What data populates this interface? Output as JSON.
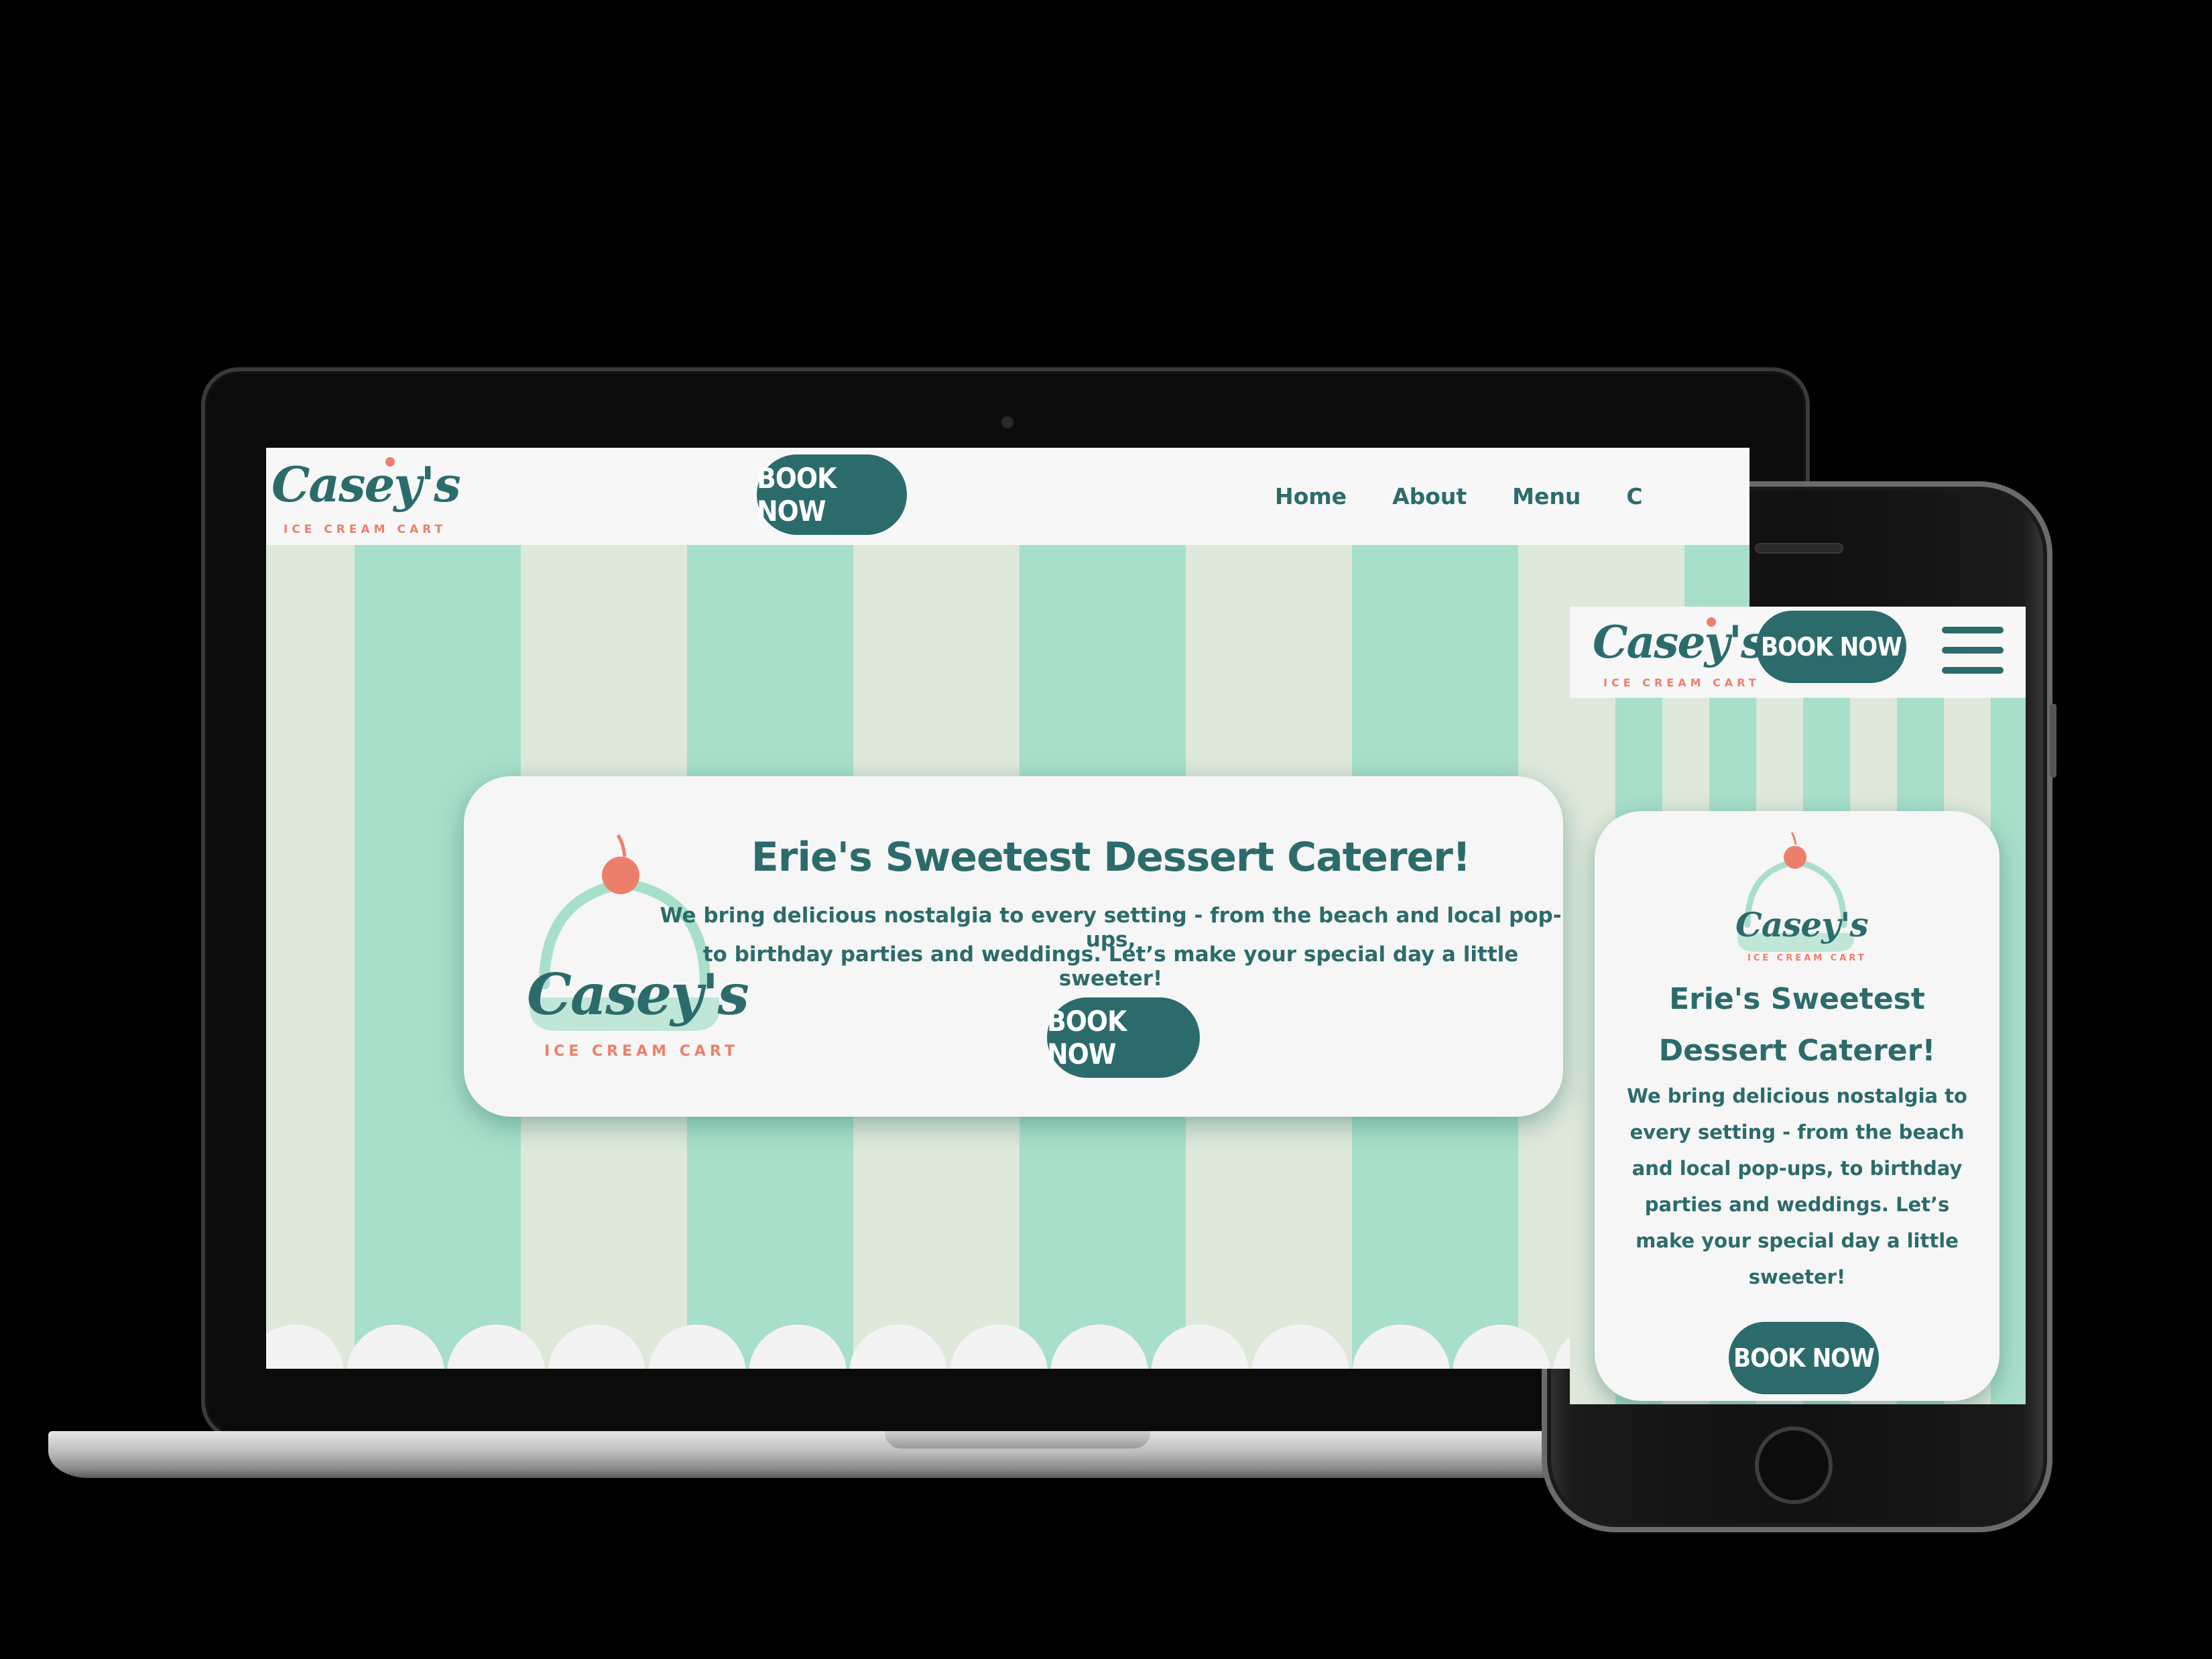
{
  "brand": {
    "name": "Casey's",
    "tagline": "ICE CREAM CART"
  },
  "colors": {
    "teal": "#2c6b6b",
    "mint_stripe": "#a8dfca",
    "cream_stripe": "#dfe9da",
    "coral": "#ec7f6b",
    "card_bg": "#f6f6f6"
  },
  "desktop": {
    "header": {
      "book_button": "BOOK NOW",
      "nav": [
        {
          "label": "Home"
        },
        {
          "label": "About"
        },
        {
          "label": "Menu"
        },
        {
          "label": "C"
        }
      ]
    },
    "hero": {
      "title": "Erie's Sweetest Dessert Caterer!",
      "line1": "We bring delicious nostalgia to every setting - from the beach and local pop-ups,",
      "line2": "to birthday parties and weddings. Let’s make your special day a little sweeter!",
      "button": "BOOK NOW"
    }
  },
  "mobile": {
    "header": {
      "book_button": "BOOK NOW",
      "menu_icon": "hamburger-icon"
    },
    "hero": {
      "title_line1": "Erie's Sweetest",
      "title_line2": "Dessert Caterer!",
      "body_lines": [
        "We bring delicious nostalgia to",
        "every setting - from the beach",
        "and local pop-ups, to birthday",
        "parties and weddings. Let’s",
        "make your special day a little",
        "sweeter!"
      ],
      "button": "BOOK NOW"
    }
  }
}
